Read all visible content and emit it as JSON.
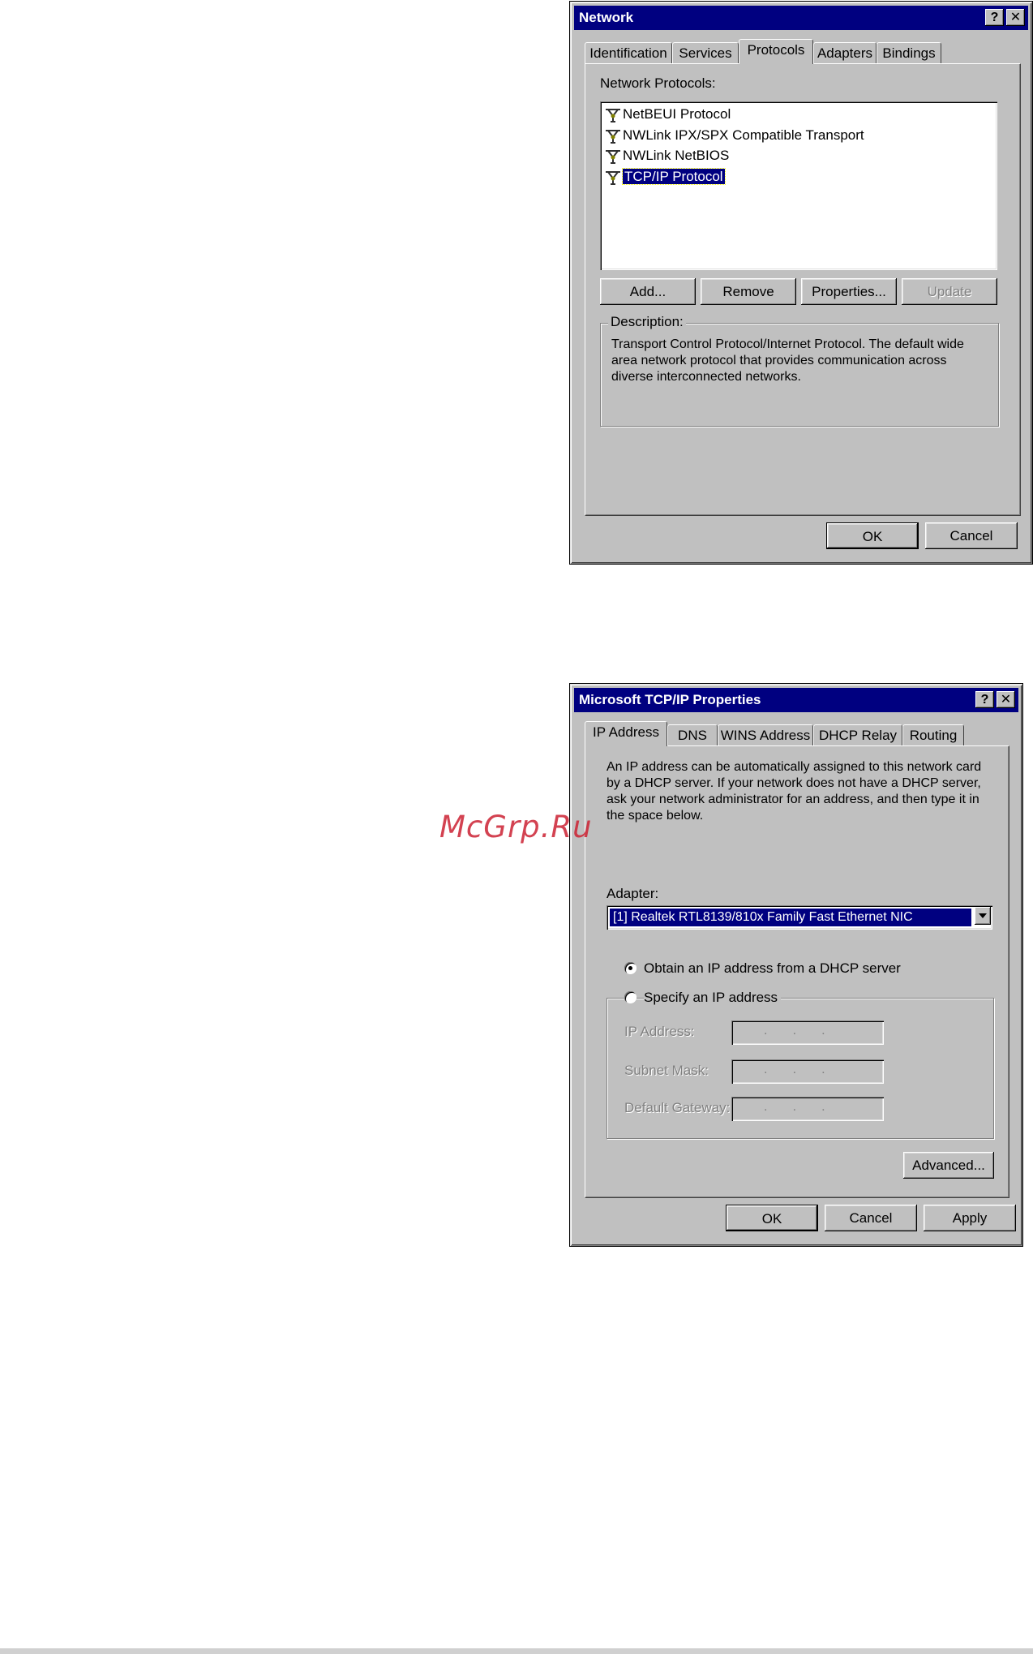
{
  "network_dialog": {
    "title": "Network",
    "help_btn": "?",
    "close_btn": "✕",
    "tabs": [
      "Identification",
      "Services",
      "Protocols",
      "Adapters",
      "Bindings"
    ],
    "list_label": "Network Protocols:",
    "protocols": [
      "NetBEUI Protocol",
      "NWLink IPX/SPX Compatible Transport",
      "NWLink NetBIOS",
      "TCP/IP Protocol"
    ],
    "buttons": {
      "add": "Add...",
      "remove": "Remove",
      "properties": "Properties...",
      "update": "Update"
    },
    "description_label": "Description:",
    "description_text": "Transport Control Protocol/Internet Protocol. The default wide area network protocol that provides communication across diverse interconnected networks.",
    "ok": "OK",
    "cancel": "Cancel"
  },
  "tcpip_dialog": {
    "title": "Microsoft TCP/IP Properties",
    "help_btn": "?",
    "close_btn": "✕",
    "tabs": [
      "IP Address",
      "DNS",
      "WINS Address",
      "DHCP Relay",
      "Routing"
    ],
    "intro_text": "An IP address can be automatically assigned to this network card by a DHCP server.  If your network does not have a DHCP server, ask your network administrator for an address, and then type it in the space below.",
    "adapter_label": "Adapter:",
    "adapter_value": "[1] Realtek RTL8139/810x Family Fast Ethernet NIC",
    "radio_dhcp": "Obtain an IP address from a DHCP server",
    "radio_specify": "Specify an IP address",
    "ip_label": "IP Address:",
    "mask_label": "Subnet Mask:",
    "gateway_label": "Default Gateway:",
    "ip_dots": ".       .       .",
    "advanced": "Advanced...",
    "ok": "OK",
    "cancel": "Cancel",
    "apply": "Apply"
  },
  "watermark": "McGrp.Ru"
}
